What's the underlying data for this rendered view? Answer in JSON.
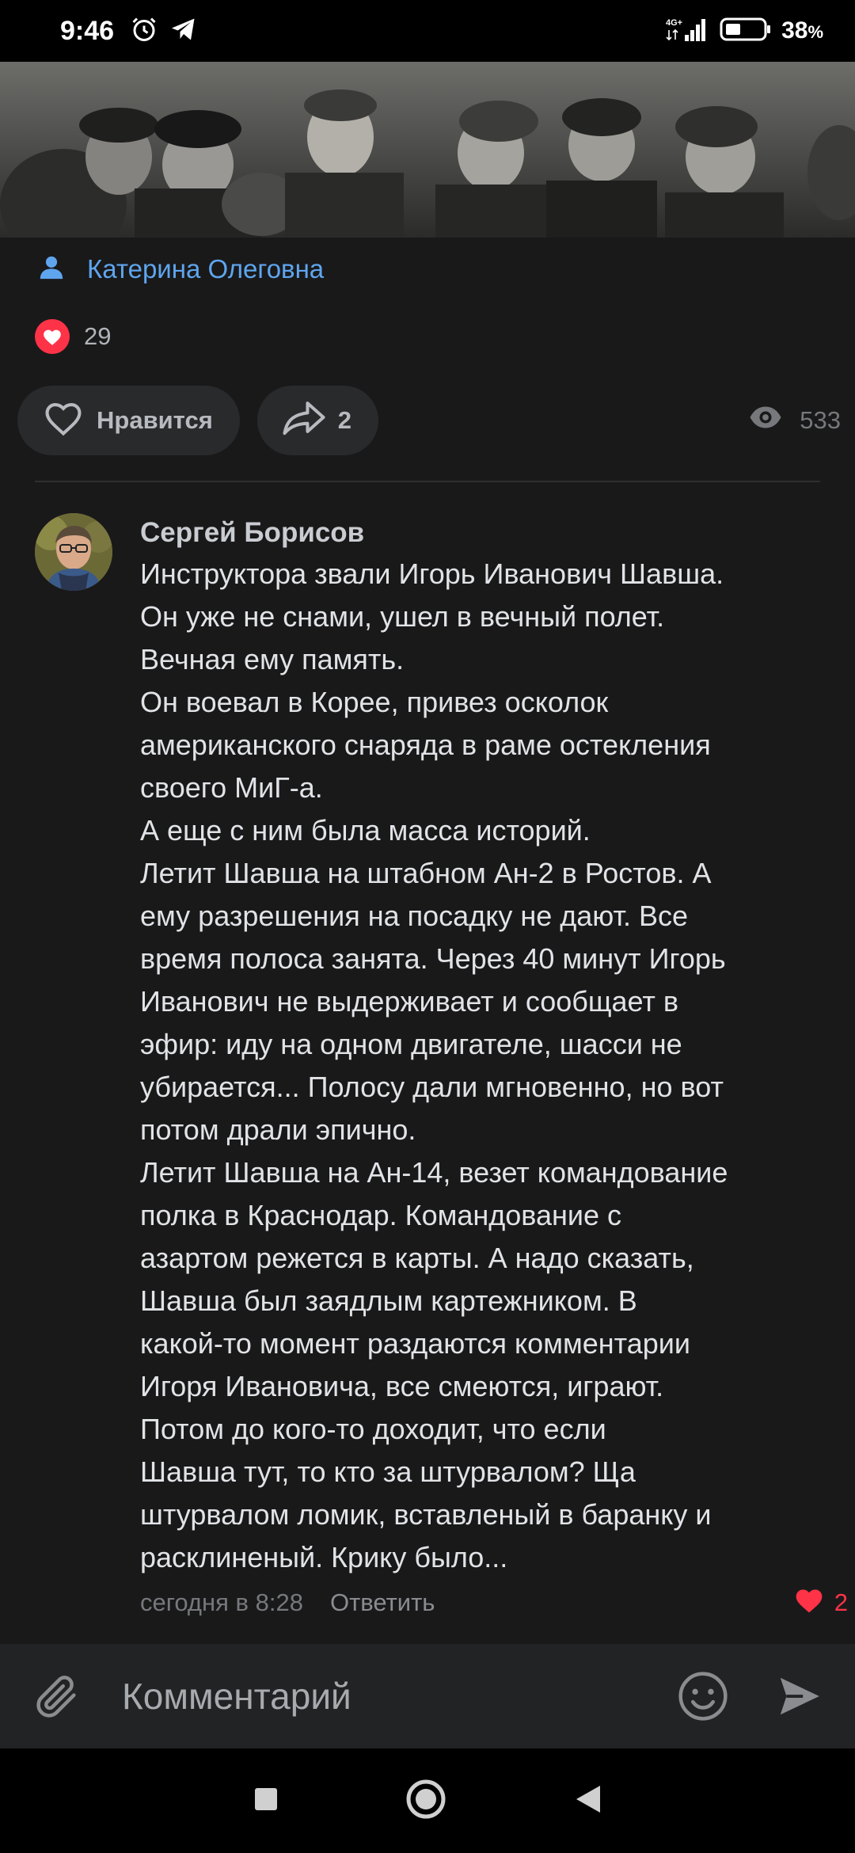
{
  "status": {
    "time": "9:46",
    "network": "4G+",
    "battery": "38",
    "battery_unit": "%"
  },
  "post": {
    "author": "Катерина Олеговна",
    "likes_count": "29",
    "like_label": "Нравится",
    "shares_count": "2",
    "views_count": "533"
  },
  "comment": {
    "author": "Сергей Борисов",
    "lines": [
      "Инструктора звали Игорь Иванович Шавша.",
      "Он уже не снами, ушел в вечный полет.",
      "Вечная ему память.",
      "Он воевал в Корее, привез осколок",
      "американского снаряда в раме остекления",
      "своего МиГ-а.",
      "А еще с ним была масса историй.",
      "Летит Шавша на штабном Ан-2 в Ростов. А",
      "ему разрешения на посадку не дают. Все",
      "время полоса занята. Через 40 минут Игорь",
      "Иванович не выдерживает и сообщает в",
      "эфир: иду на одном двигателе, шасси не",
      "убирается... Полосу дали мгновенно, но вот",
      "потом драли эпично.",
      "Летит Шавша на Ан-14, везет командование",
      "полка в Краснодар. Командование с",
      "азартом режется в карты. А надо сказать,",
      "Шавша был заядлым картежником. В",
      "какой-то момент раздаются комментарии",
      "Игоря Ивановича, все смеются, играют.",
      "Потом до кого-то доходит, что если",
      "Шавша тут, то кто за штурвалом? Ща",
      "штурвалом ломик, вставленый в баранку и",
      "расклиненый. Крику было..."
    ],
    "timestamp": "сегодня в 8:28",
    "reply_label": "Ответить",
    "likes_count": "2"
  },
  "input": {
    "placeholder": "Комментарий"
  },
  "colors": {
    "accent": "#5fa5ee",
    "like": "#ff3347",
    "background": "#19191a"
  }
}
